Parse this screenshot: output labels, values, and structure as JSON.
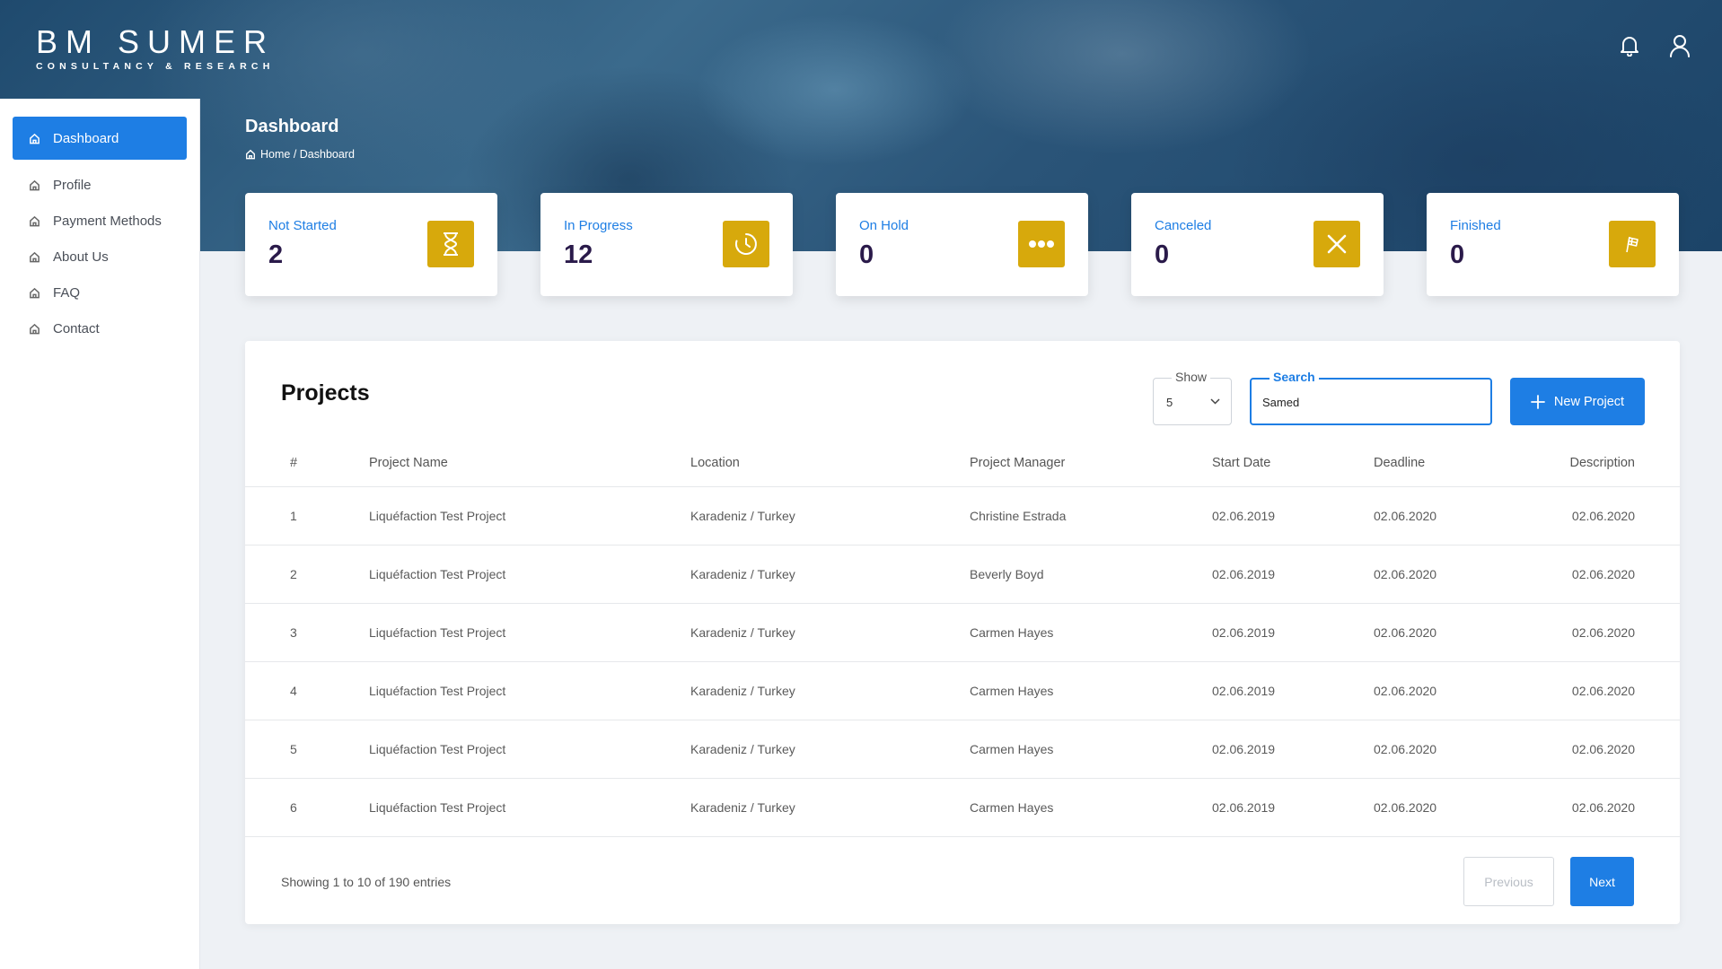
{
  "brand": {
    "name": "BM SUMER",
    "tagline": "CONSULTANCY & RESEARCH"
  },
  "sidebar": {
    "items": [
      {
        "label": "Dashboard",
        "active": true
      },
      {
        "label": "Profile"
      },
      {
        "label": "Payment Methods"
      },
      {
        "label": "About Us"
      },
      {
        "label": "FAQ"
      },
      {
        "label": "Contact"
      }
    ]
  },
  "header": {
    "title": "Dashboard",
    "breadcrumb": "Home / Dashboard"
  },
  "stats": [
    {
      "label": "Not Started",
      "value": "2",
      "icon": "hourglass-icon"
    },
    {
      "label": "In Progress",
      "value": "12",
      "icon": "clock-icon"
    },
    {
      "label": "On Hold",
      "value": "0",
      "icon": "more-dots-icon"
    },
    {
      "label": "Canceled",
      "value": "0",
      "icon": "close-icon"
    },
    {
      "label": "Finished",
      "value": "0",
      "icon": "flag-icon"
    }
  ],
  "projects": {
    "title": "Projects",
    "show_label": "Show",
    "show_value": "5",
    "search_label": "Search",
    "search_value": "Samed",
    "new_button": "New Project",
    "columns": [
      "#",
      "Project Name",
      "Location",
      "Project Manager",
      "Start Date",
      "Deadline",
      "Description"
    ],
    "rows": [
      [
        "1",
        "Liquéfaction Test Project",
        "Karadeniz / Turkey",
        "Christine Estrada",
        "02.06.2019",
        "02.06.2020",
        "02.06.2020"
      ],
      [
        "2",
        "Liquéfaction Test Project",
        "Karadeniz / Turkey",
        "Beverly Boyd",
        "02.06.2019",
        "02.06.2020",
        "02.06.2020"
      ],
      [
        "3",
        "Liquéfaction Test Project",
        "Karadeniz / Turkey",
        "Carmen Hayes",
        "02.06.2019",
        "02.06.2020",
        "02.06.2020"
      ],
      [
        "4",
        "Liquéfaction Test Project",
        "Karadeniz / Turkey",
        "Carmen Hayes",
        "02.06.2019",
        "02.06.2020",
        "02.06.2020"
      ],
      [
        "5",
        "Liquéfaction Test Project",
        "Karadeniz / Turkey",
        "Carmen Hayes",
        "02.06.2019",
        "02.06.2020",
        "02.06.2020"
      ],
      [
        "6",
        "Liquéfaction Test Project",
        "Karadeniz / Turkey",
        "Carmen Hayes",
        "02.06.2019",
        "02.06.2020",
        "02.06.2020"
      ]
    ],
    "footer_info": "Showing 1 to 10 of 190 entries",
    "prev_label": "Previous",
    "next_label": "Next"
  },
  "colors": {
    "accent": "#1e7ee4",
    "stat_icon_bg": "#d7a90c",
    "stat_value": "#2a1a4a"
  }
}
